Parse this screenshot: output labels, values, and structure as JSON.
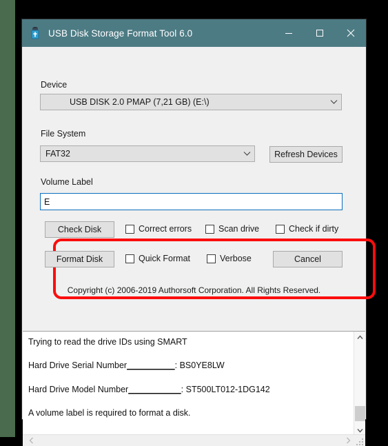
{
  "window": {
    "title": "USB Disk Storage Format Tool 6.0",
    "icon": "usb-drive-icon",
    "titlebar_color": "#4d7b84",
    "controls": {
      "minimize": "minimize-icon",
      "maximize": "maximize-icon",
      "close": "close-icon"
    }
  },
  "form": {
    "device": {
      "label": "Device",
      "value": "USB DISK 2.0  PMAP (7,21 GB) (E:\\)"
    },
    "file_system": {
      "label": "File System",
      "value": "FAT32"
    },
    "refresh_button": "Refresh Devices",
    "volume_label": {
      "label": "Volume Label",
      "value": "E",
      "placeholder": ""
    }
  },
  "actions": {
    "check_disk_button": "Check Disk",
    "format_disk_button": "Format Disk",
    "cancel_button": "Cancel",
    "checkboxes": [
      {
        "label": "Correct errors",
        "checked": false
      },
      {
        "label": "Scan drive",
        "checked": false
      },
      {
        "label": "Check if dirty",
        "checked": false
      },
      {
        "label": "Quick Format",
        "checked": false
      },
      {
        "label": "Verbose",
        "checked": false
      }
    ],
    "highlight_color": "#fb0d0d"
  },
  "copyright": "Copyright (c) 2006-2019 Authorsoft Corporation. All Rights Reserved.",
  "log": {
    "line1": "Trying to read the drive IDs using SMART",
    "line2_label": "Hard Drive Serial Number",
    "line2_fill": "__________",
    "line2_value": ": BS0YE8LW",
    "line3_label": "Hard Drive Model Number",
    "line3_fill": "___________",
    "line3_value": ": ST500LT012-1DG142",
    "line4": "A volume label is required to format a disk."
  }
}
